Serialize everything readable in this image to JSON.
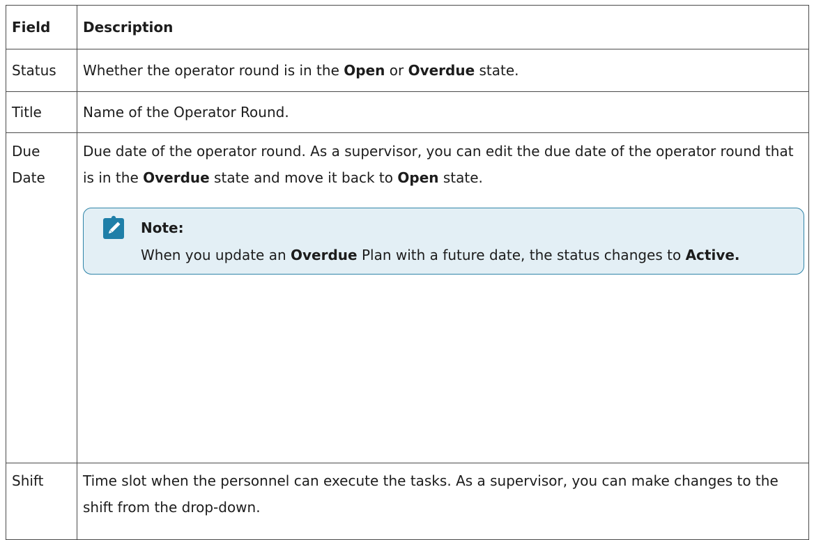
{
  "table": {
    "header": {
      "field": "Field",
      "description": "Description"
    },
    "rows": {
      "status": {
        "field": "Status",
        "d1": "Whether the operator round is in the ",
        "b1": "Open",
        "d2": " or ",
        "b2": "Overdue",
        "d3": " state."
      },
      "title": {
        "field": "Title",
        "d1": "Name of the Operator Round."
      },
      "due": {
        "field": "Due Date",
        "d1": "Due date of the operator round. As a supervisor, you can edit the due date of the operator round that is in the ",
        "b1": "Overdue",
        "d2": " state and move it back to ",
        "b2": "Open",
        "d3": " state.",
        "note": {
          "title": "Note:",
          "icon": "note-pencil-icon",
          "t1": "When you update an ",
          "b1": "Overdue",
          "t2": " Plan with a future date, the status changes to ",
          "b2": "Active."
        }
      },
      "shift": {
        "field": "Shift",
        "d1": "Time slot when the personnel can execute the tasks. As a supervisor, you can make changes to the shift from the drop-down."
      }
    }
  },
  "colors": {
    "note_border": "#2e84a8",
    "note_bg": "#e3eff5",
    "icon": "#1f7fa8"
  }
}
